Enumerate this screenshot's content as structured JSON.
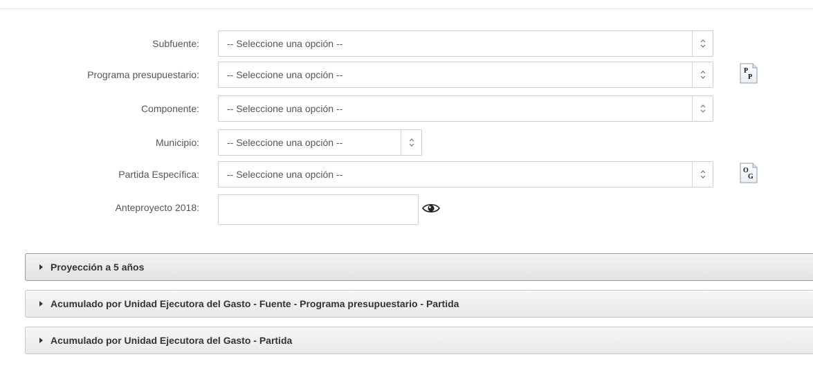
{
  "form": {
    "subfuente": {
      "label": "Subfuente:",
      "selected": "-- Seleccione una opción --"
    },
    "programa": {
      "label": "Programa presupuestario:",
      "selected": "-- Seleccione una opción --",
      "icon_text_top": "P",
      "icon_text_bottom": "P"
    },
    "componente": {
      "label": "Componente:",
      "selected": "-- Seleccione una opción --"
    },
    "municipio": {
      "label": "Municipio:",
      "selected": "-- Seleccione una opción --"
    },
    "partida": {
      "label": "Partida Específica:",
      "selected": "-- Seleccione una opción --",
      "icon_text_top": "O",
      "icon_text_bottom": "G"
    },
    "anteproyecto": {
      "label": "Anteproyecto 2018:",
      "value": ""
    }
  },
  "accordions": [
    {
      "title": "Proyección a 5 años"
    },
    {
      "title": "Acumulado por Unidad Ejecutora del Gasto - Fuente - Programa presupuestario - Partida"
    },
    {
      "title": "Acumulado por Unidad Ejecutora del Gasto - Partida"
    }
  ],
  "icons": {
    "select_arrows": "up-down-arrows-icon",
    "doc": "document-letter-icon",
    "view": "eye-icon",
    "expand": "caret-right-icon"
  }
}
